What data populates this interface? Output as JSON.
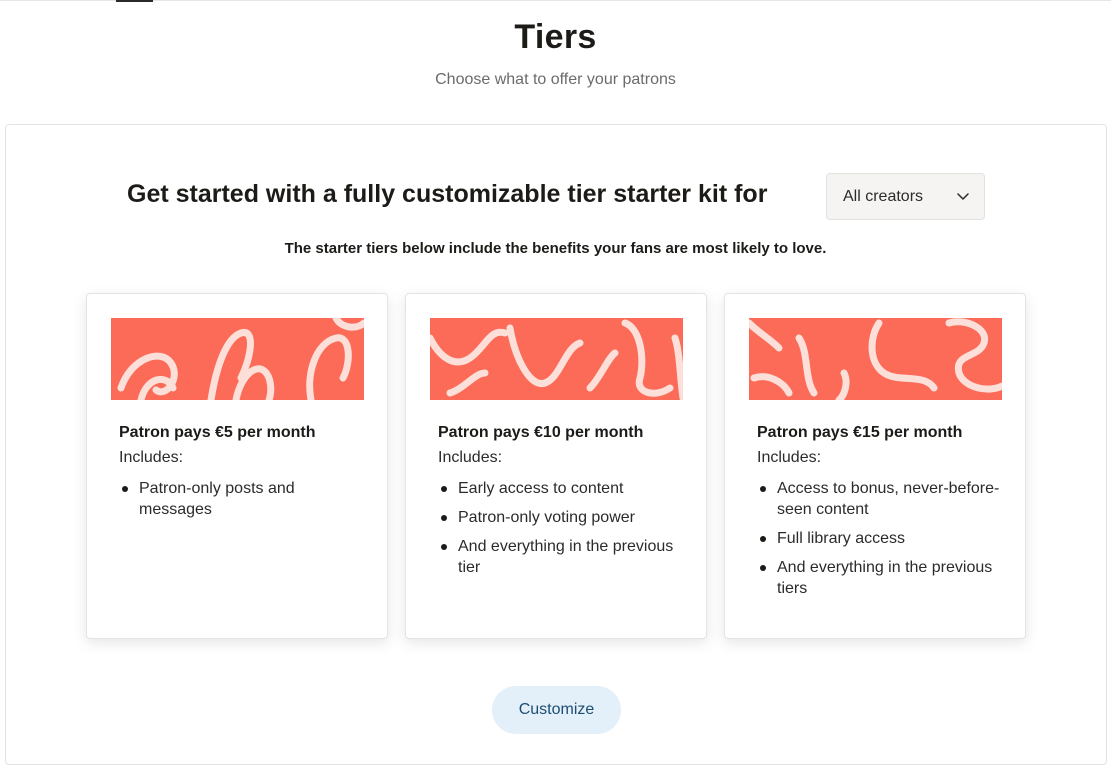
{
  "header": {
    "title": "Tiers",
    "subtitle": "Choose what to offer your patrons"
  },
  "kit": {
    "heading": "Get started with a fully customizable tier starter kit for",
    "select_value": "All creators",
    "subheading": "The starter tiers below include the benefits your fans are most likely to love."
  },
  "tiers": [
    {
      "title": "Patron pays €5 per month",
      "includes_label": "Includes:",
      "benefits": [
        "Patron-only posts and messages"
      ]
    },
    {
      "title": "Patron pays €10 per month",
      "includes_label": "Includes:",
      "benefits": [
        "Early access to content",
        "Patron-only voting power",
        "And everything in the previous tier"
      ]
    },
    {
      "title": "Patron pays €15 per month",
      "includes_label": "Includes:",
      "benefits": [
        "Access to bonus, never-before-seen content",
        "Full library access",
        "And everything in the previous tiers"
      ]
    }
  ],
  "actions": {
    "customize_label": "Customize"
  },
  "colors": {
    "banner": "#fc6a58",
    "banner_stroke": "#fbe9e3",
    "button_bg": "#e3eff9",
    "button_text": "#1c4e73"
  },
  "icons": {
    "select_chevron": "chevron-down-icon"
  }
}
